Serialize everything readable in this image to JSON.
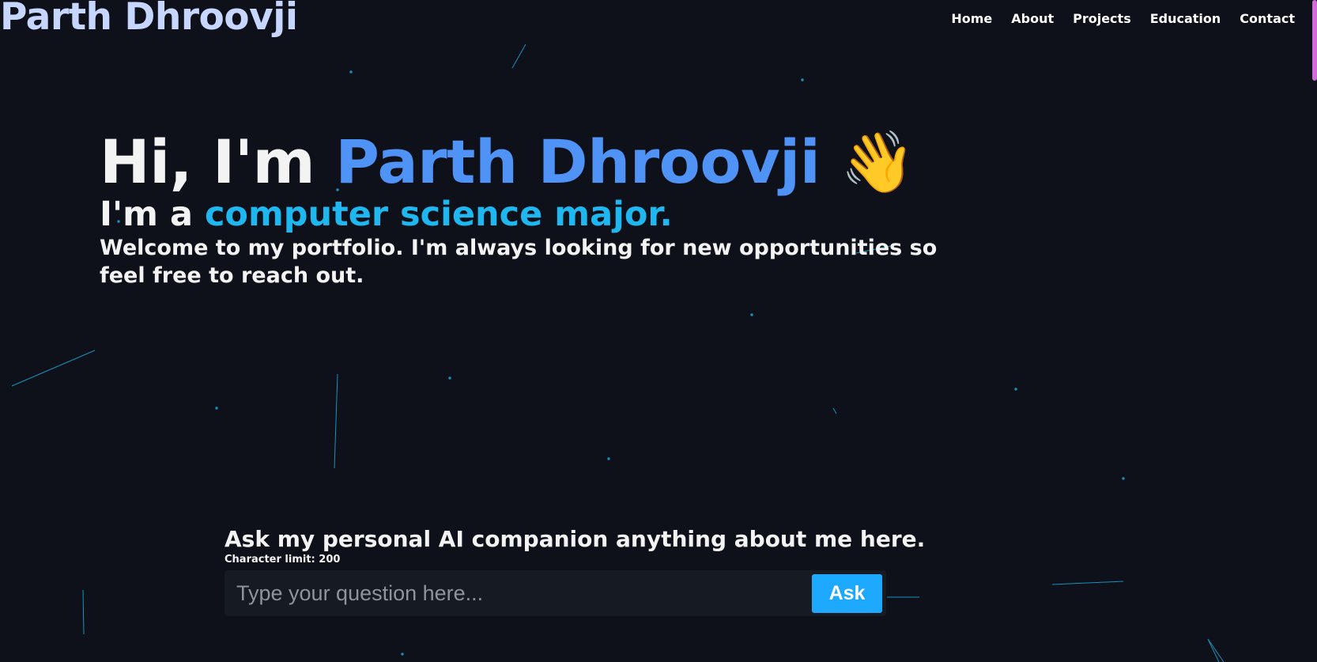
{
  "header": {
    "logo": "Parth Dhroovji",
    "nav": [
      "Home",
      "About",
      "Projects",
      "Education",
      "Contact"
    ]
  },
  "hero": {
    "greeting": "Hi, I'm ",
    "name": "Parth Dhroovji",
    "wave_emoji": "👋",
    "subtitle_prefix": "I'm a ",
    "subtitle_role": "computer science major.",
    "description": "Welcome to my portfolio. I'm always looking for new opportunities so feel free to reach out."
  },
  "ai_companion": {
    "title": "Ask my personal AI companion anything about me here.",
    "limit": "Character limit: 200",
    "placeholder": "Type your question here...",
    "button": "Ask"
  },
  "colors": {
    "background": "#0e111a",
    "logo": "#c7d6ff",
    "name_accent": "#4f93f7",
    "role_accent": "#1fb7f0",
    "button": "#1da9ff",
    "particles": "#1aa7d8",
    "scroll_thumb": "#d06bd8"
  }
}
